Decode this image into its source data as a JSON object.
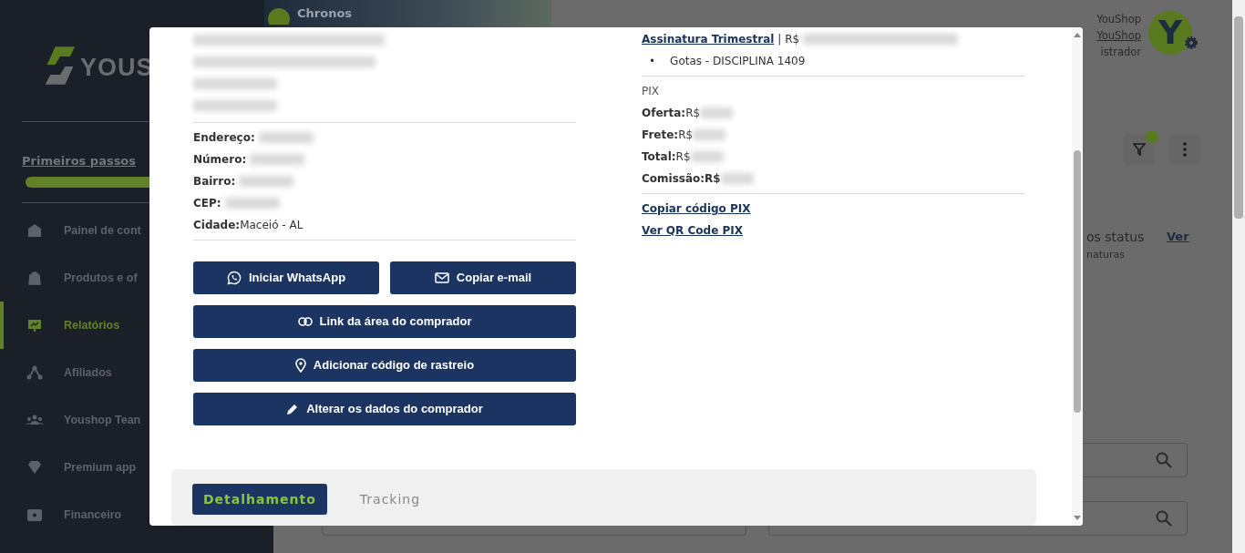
{
  "sidebar": {
    "logo_text": "YOUS",
    "guide_link": "Primeiros passos",
    "progress": {
      "level": 0.6
    },
    "items": [
      {
        "label": "Painel de cont",
        "selected": false
      },
      {
        "label": "Produtos e of",
        "selected": false
      },
      {
        "label": "Relatórios",
        "selected": true
      },
      {
        "label": "Afiliados",
        "selected": false
      },
      {
        "label": "Youshop Tean",
        "selected": false
      },
      {
        "label": "Premium app",
        "selected": false
      },
      {
        "label": "Financeiro",
        "selected": false
      }
    ]
  },
  "header": {
    "banner_title": "Chronos",
    "user_name": "YouShop",
    "user_link": "YouShop",
    "user_role": "istrador",
    "avatar_letter": "Y"
  },
  "toolbar": {
    "filter_active": true
  },
  "status_card": {
    "title": "os status",
    "link": "Ver",
    "subtitle": "naturas"
  },
  "modal": {
    "address": [
      {
        "label": "Endereço:",
        "redacted": true
      },
      {
        "label": "Número:",
        "redacted": true
      },
      {
        "label": "Bairro:",
        "redacted": true
      },
      {
        "label": "CEP:",
        "redacted": true
      },
      {
        "label": "Cidade:",
        "value": "Maceió - AL",
        "redacted": false
      }
    ],
    "buttons": [
      {
        "label": "Iniciar WhatsApp",
        "kind": "half"
      },
      {
        "label": "Copiar e-mail",
        "kind": "half"
      },
      {
        "label": "Link da área do comprador",
        "kind": "full"
      },
      {
        "label": "Adicionar código de rastreio",
        "kind": "full"
      },
      {
        "label": "Alterar os dados do comprador",
        "kind": "full"
      }
    ],
    "product": {
      "name": "Assinatura Trimestral",
      "price_prefix": "| R$",
      "bullet": "•",
      "items": [
        "Gotas - DISCIPLINA 1409"
      ]
    },
    "payment": {
      "method": "PIX",
      "rows": [
        {
          "label": "Oferta:",
          "value": "R$",
          "strong": false
        },
        {
          "label": "Frete:",
          "value": "R$",
          "strong": false
        },
        {
          "label": "Total:",
          "value": "R$",
          "strong": false
        },
        {
          "label": "Comissão:",
          "value": "R$",
          "strong": true
        }
      ],
      "links": [
        "Copiar código PIX",
        "Ver QR Code PIX"
      ]
    },
    "tabs": [
      {
        "label": "Detalhamento",
        "selected": true
      },
      {
        "label": "Tracking",
        "selected": false
      }
    ]
  }
}
